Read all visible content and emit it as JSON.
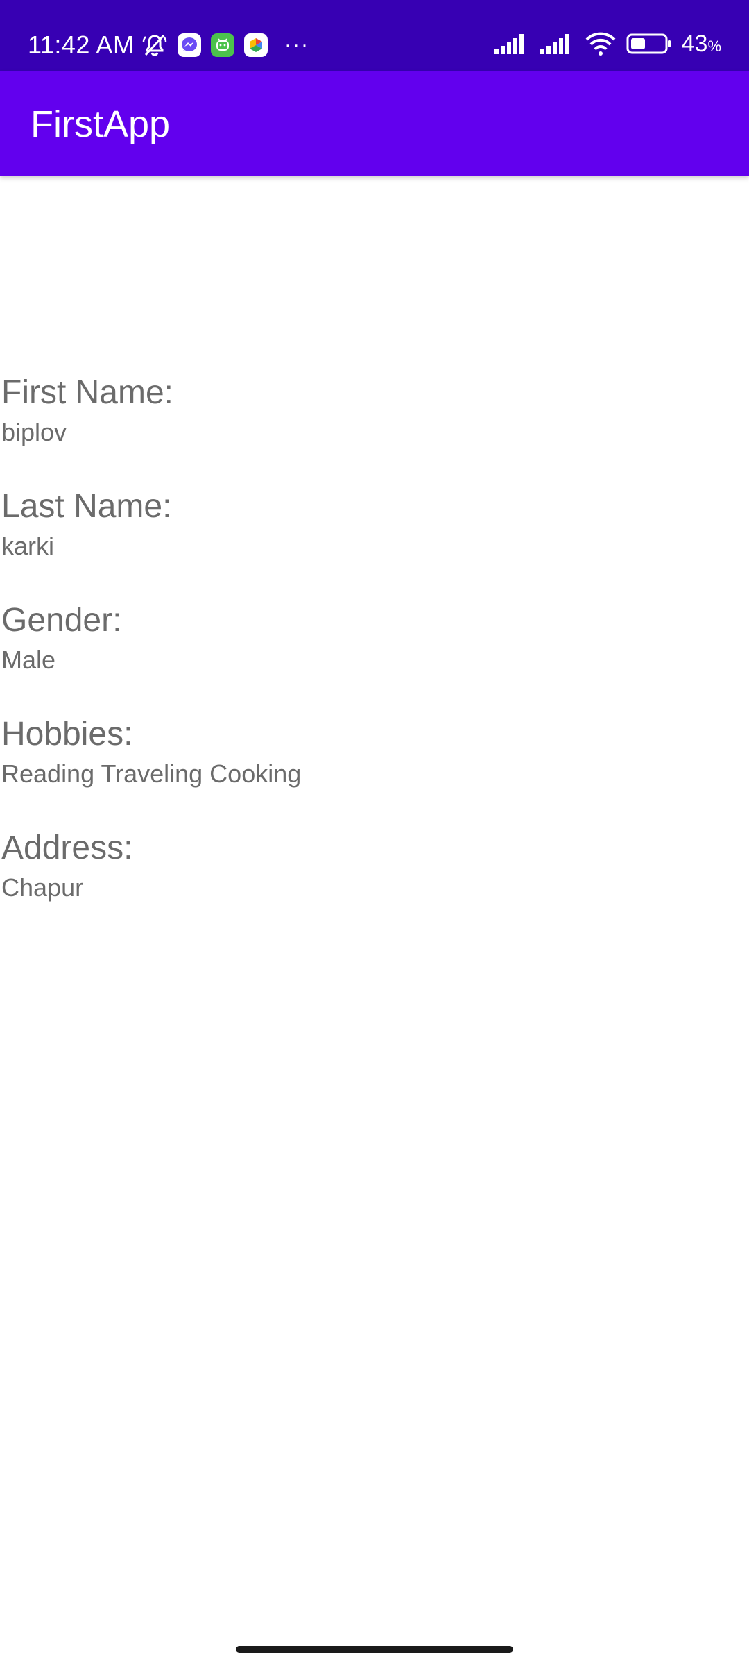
{
  "status_bar": {
    "time": "11:42 AM",
    "battery_percent": "43",
    "battery_symbol": "%",
    "battery_level": 0.43,
    "background_color": "#3700b3"
  },
  "app_bar": {
    "title": "FirstApp",
    "background_color": "#6200ee"
  },
  "fields": [
    {
      "label": "First Name:",
      "value": "biplov"
    },
    {
      "label": "Last Name:",
      "value": "karki"
    },
    {
      "label": "Gender:",
      "value": "Male"
    },
    {
      "label": "Hobbies:",
      "value": "Reading Traveling Cooking"
    },
    {
      "label": "Address:",
      "value": "Chapur"
    }
  ],
  "icons": {
    "status_left": [
      "mute-icon",
      "messenger-icon",
      "green-app-icon",
      "app-store-icon",
      "more-notifications-icon"
    ],
    "status_right": [
      "signal-icon",
      "signal-icon",
      "wifi-icon",
      "battery-icon"
    ]
  }
}
